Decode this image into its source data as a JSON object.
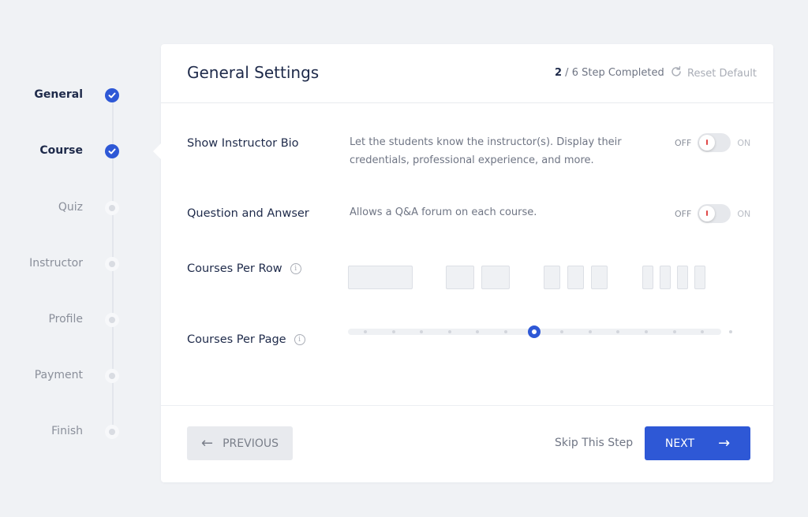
{
  "steps": [
    {
      "label": "General",
      "status": "done"
    },
    {
      "label": "Course",
      "status": "done"
    },
    {
      "label": "Quiz",
      "status": "todo"
    },
    {
      "label": "Instructor",
      "status": "todo"
    },
    {
      "label": "Profile",
      "status": "todo"
    },
    {
      "label": "Payment",
      "status": "todo"
    },
    {
      "label": "Finish",
      "status": "todo"
    }
  ],
  "header": {
    "title": "General Settings",
    "progress_current": "2",
    "progress_rest": " / 6 Step Completed",
    "reset_label": "Reset Default"
  },
  "settings": {
    "instructor_bio": {
      "label": "Show Instructor Bio",
      "description": "Let the students know the instructor(s). Display their credentials, professional experience, and more.",
      "off_label": "OFF",
      "on_label": "ON",
      "state": "off"
    },
    "qna": {
      "label": "Question and Anwser",
      "description": "Allows a Q&A forum on each course.",
      "off_label": "OFF",
      "on_label": "ON",
      "state": "off"
    },
    "courses_per_row": {
      "label": "Courses Per Row",
      "options": [
        1,
        2,
        3,
        4
      ]
    },
    "courses_per_page": {
      "label": "Courses Per Page",
      "steps": 14,
      "selected_step": 7
    }
  },
  "footer": {
    "previous_label": "PREVIOUS",
    "skip_label": "Skip This Step",
    "next_label": "NEXT"
  },
  "colors": {
    "accent": "#2e58d6",
    "background": "#f0f2f5",
    "toggle_off_mark": "#e04848"
  }
}
